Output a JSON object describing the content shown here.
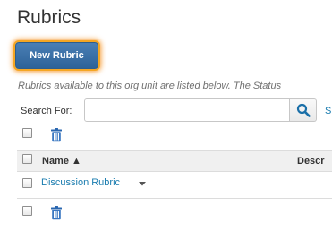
{
  "page": {
    "title": "Rubrics"
  },
  "toolbar": {
    "new_rubric_label": "New Rubric"
  },
  "description": "Rubrics available to this org unit are listed below. The Status",
  "search": {
    "label": "Search For:",
    "value": "",
    "placeholder": "",
    "show_options_label": "S"
  },
  "table": {
    "columns": {
      "name": "Name ▲",
      "description": "Descr"
    },
    "rows": [
      {
        "name": "Discussion Rubric"
      }
    ]
  },
  "icons": {
    "search": "search-icon",
    "delete": "trash-icon",
    "sort": "sort-ascending-icon",
    "context_menu": "chevron-down-icon"
  },
  "colors": {
    "primary_button": "#2d6399",
    "focus_glow": "#f5a623",
    "link": "#1a7caf",
    "search_icon": "#1a6fa8",
    "trash_icon": "#2a67b0"
  }
}
